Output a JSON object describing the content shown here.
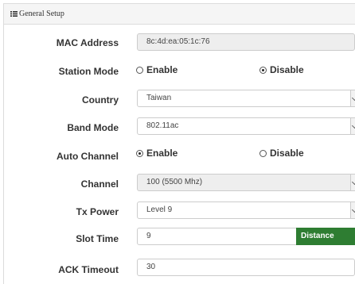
{
  "header": {
    "title": "General Setup",
    "icon": "list-icon"
  },
  "form": {
    "mac_address": {
      "label": "MAC Address",
      "value": "8c:4d:ea:05:1c:76"
    },
    "station_mode": {
      "label": "Station Mode",
      "options": [
        "Enable",
        "Disable"
      ],
      "selected": "Disable"
    },
    "country": {
      "label": "Country",
      "value": "Taiwan"
    },
    "band_mode": {
      "label": "Band Mode",
      "value": "802.11ac"
    },
    "auto_channel": {
      "label": "Auto Channel",
      "options": [
        "Enable",
        "Disable"
      ],
      "selected": "Enable"
    },
    "channel": {
      "label": "Channel",
      "value": "100 (5500 Mhz)"
    },
    "tx_power": {
      "label": "Tx Power",
      "value": "Level 9"
    },
    "slot_time": {
      "label": "Slot Time",
      "value": "9",
      "addon": "Distance"
    },
    "ack_timeout": {
      "label": "ACK Timeout",
      "value": "30"
    }
  },
  "colors": {
    "addon_bg": "#2e7d32",
    "header_bg": "#f5f5f5"
  }
}
